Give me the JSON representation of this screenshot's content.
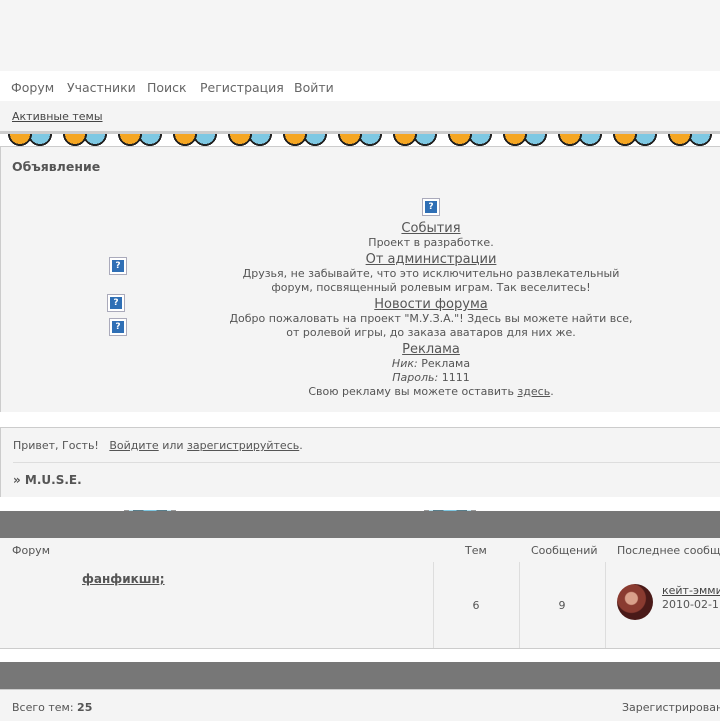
{
  "nav": {
    "items": [
      "Форум",
      "Участники",
      "Поиск",
      "Регистрация",
      "Войти"
    ]
  },
  "active_topics": "Активные темы",
  "announcement": {
    "title": "Объявление",
    "sections": [
      {
        "link": "События",
        "text": "Проект в разработке."
      },
      {
        "link": "От администрации",
        "text_line1": "Друзья, не забывайте, что это исключительно развлекательный",
        "text_line2": "форум, посвященный ролевым играм. Так веселитесь!"
      },
      {
        "link": "Новости форума",
        "text_line1": "Добро пожаловать на проект \"М.У.З.А.\"! Здесь вы можете найти все,",
        "text_line2": "от ролевой игры, до заказа аватаров для них же."
      },
      {
        "link": "Реклама"
      }
    ],
    "ad": {
      "nick_label": "Ник:",
      "nick_value": "Реклама",
      "pass_label": "Пароль:",
      "pass_value": "1111",
      "text_before": "Свою рекламу вы можете оставить ",
      "link": "здесь",
      "text_after": "."
    }
  },
  "greeting": {
    "hello": "Привет, Гость!",
    "login": "Войдите",
    "or": " или ",
    "register": "зарегистрируйтесь",
    "end": "."
  },
  "breadcrumb": "» M.U.S.E.",
  "table": {
    "headers": {
      "forum": "Форум",
      "topics": "Тем",
      "posts": "Сообщений",
      "last": "Последнее сообщ"
    },
    "rows": [
      {
        "name": "фанфикшн;",
        "topics": "6",
        "posts": "9",
        "last_user": "кейт-эмми",
        "last_date": "2010-02-1"
      }
    ]
  },
  "stats": {
    "total_label": "Всего тем: ",
    "total_value": "25",
    "registered": "Зарегистрирован"
  },
  "colors": {
    "panel": "#f4f4f4",
    "band": "#777777",
    "accent_yellow": "#ffd500",
    "accent_blue": "#7ec8e3"
  }
}
